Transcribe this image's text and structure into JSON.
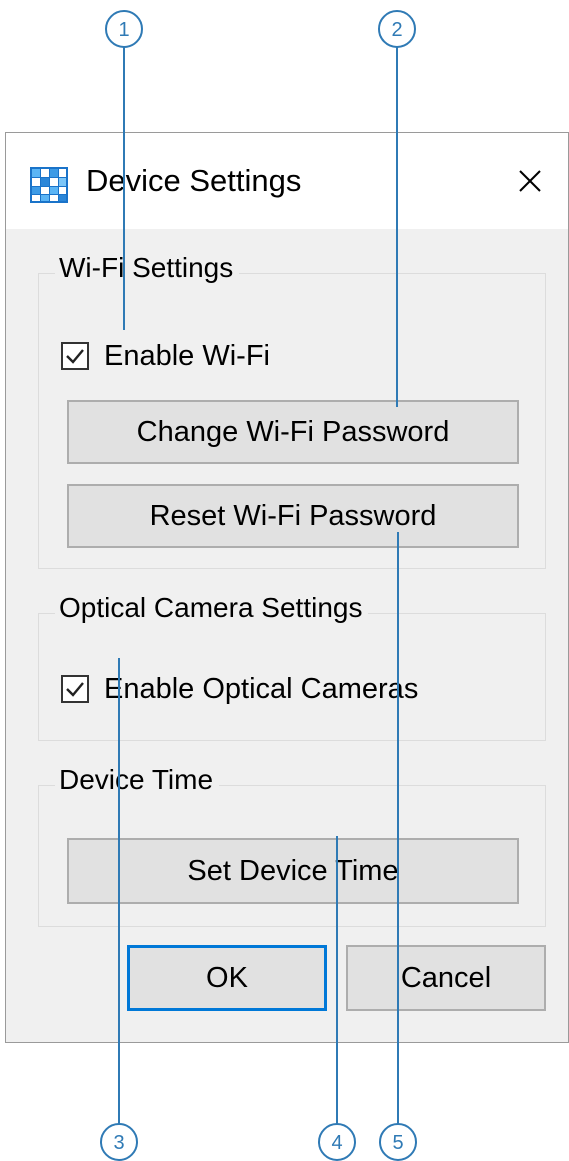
{
  "window": {
    "title": "Device Settings",
    "app_icon": "grid-app-icon",
    "close_icon": "close-icon"
  },
  "wifi_group": {
    "label": "Wi-Fi Settings",
    "enable_label": "Enable Wi-Fi",
    "enable_checked": true,
    "change_password_label": "Change Wi-Fi Password",
    "reset_password_label": "Reset Wi-Fi Password"
  },
  "camera_group": {
    "label": "Optical Camera Settings",
    "enable_label": "Enable Optical Cameras",
    "enable_checked": true
  },
  "time_group": {
    "label": "Device Time",
    "set_time_label": "Set Device Time"
  },
  "footer": {
    "ok_label": "OK",
    "cancel_label": "Cancel"
  },
  "callouts": [
    "1",
    "2",
    "3",
    "4",
    "5"
  ],
  "colors": {
    "callout": "#2f7ab5",
    "default_button_border": "#0078d7",
    "dialog_background": "#f0f0f0"
  }
}
